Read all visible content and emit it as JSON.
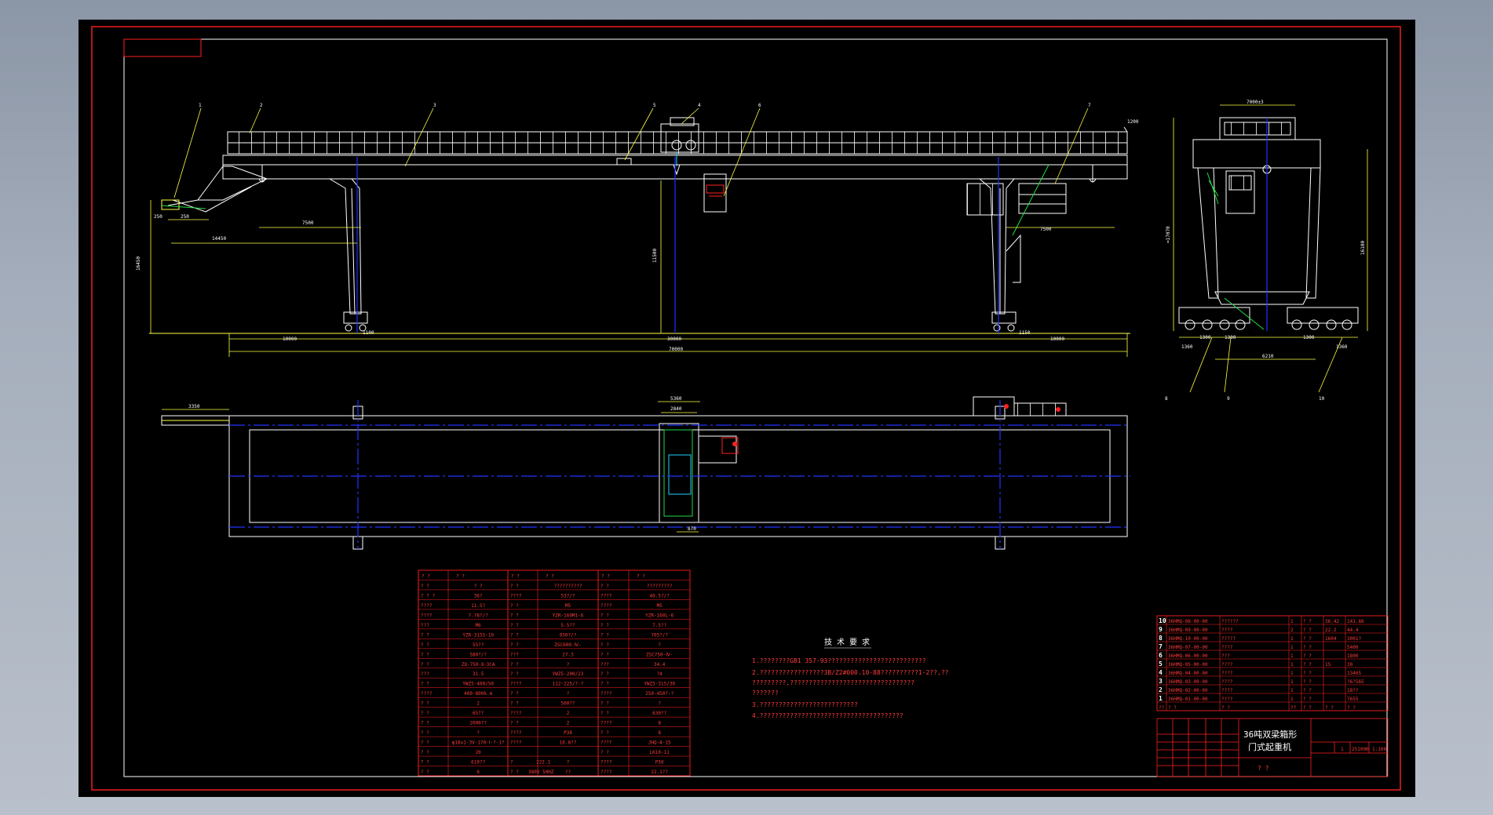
{
  "colors": {
    "paper": "#000000",
    "frame": "#ff2020",
    "line": "#ffffff",
    "dim": "#ffff33",
    "center": "#2233ff",
    "green": "#22dd44",
    "cyan": "#22d0ff"
  },
  "callouts": [
    "1",
    "2",
    "3",
    "5",
    "4",
    "6",
    "7",
    "8",
    "9",
    "10"
  ],
  "dims": {
    "elev_top": [
      "250",
      "250",
      "7500",
      "14450",
      "7500"
    ],
    "elev_v": [
      "16450",
      "11500"
    ],
    "elev_bot": [
      "10000",
      "1100",
      "30000",
      "1150",
      "10000",
      "70000"
    ],
    "plan": [
      "3350",
      "5360",
      "2840",
      "870"
    ],
    "side": [
      "7000±3",
      "≈17070",
      "16100",
      "1360",
      "1300",
      "1300",
      "1300",
      "1360",
      "6210"
    ],
    "note_1200": "1200"
  },
  "params": {
    "col_headers": [
      "? ?",
      "? ?",
      "? ?",
      "? ?",
      "? ?",
      "? ?"
    ],
    "col1": [
      [
        "? ?",
        "? ?"
      ],
      [
        "? ? ?",
        "36?"
      ],
      [
        "????",
        "11.5?"
      ],
      [
        "????",
        "7.78?/?"
      ],
      [
        "???",
        "M6"
      ],
      [
        "? ?",
        "YZR-315S-10"
      ],
      [
        "? ?",
        "55??"
      ],
      [
        "? ?",
        "580?/?"
      ],
      [
        "? ?",
        "ZQ-750-Ⅱ-3CA"
      ],
      [
        "???",
        "31.5"
      ],
      [
        "? ?",
        "YWZ5-400/50"
      ],
      [
        "????",
        "400-800k.m"
      ],
      [
        "? ?",
        "2"
      ],
      [
        "? ?",
        "65??"
      ],
      [
        "? ?",
        "2000??"
      ],
      [
        "? ?",
        "?"
      ],
      [
        "? ?",
        "φ18x1-3V-170-Ⅰ-?-1?"
      ],
      [
        "? ?",
        "20"
      ],
      [
        "? ?",
        "610??"
      ],
      [
        "? ?",
        "6"
      ]
    ],
    "col2": [
      [
        "? ?",
        "??????????"
      ],
      [
        "????",
        "53?/?"
      ],
      [
        "? ?",
        "M5"
      ],
      [
        "? ?",
        "YZR-160M1-6"
      ],
      [
        "? ?",
        "5.5??"
      ],
      [
        "? ?",
        "930?/?"
      ],
      [
        "? ?",
        "ZSC600-Ⅳ-"
      ],
      [
        "???",
        "27.3"
      ],
      [
        "? ?",
        "?"
      ],
      [
        "? ?",
        "YWZ5-200/23"
      ],
      [
        "????",
        "112-225/?-?"
      ],
      [
        "? ?",
        "?"
      ],
      [
        "? ?",
        "500??"
      ],
      [
        "????",
        "2"
      ],
      [
        "? ?",
        "2"
      ],
      [
        "????",
        "P38"
      ],
      [
        "????",
        "16.8??"
      ],
      [
        "",
        ""
      ],
      [
        "?",
        "?"
      ],
      [
        "? ?",
        "??"
      ]
    ],
    "col3": [
      [
        "? ?",
        "?????????"
      ],
      [
        "????",
        "40.5?/?"
      ],
      [
        "????",
        "M5"
      ],
      [
        "? ?",
        "YZR-160L-6"
      ],
      [
        "? ?",
        "7.5??"
      ],
      [
        "? ?",
        "705?/?"
      ],
      [
        "? ?",
        "?"
      ],
      [
        "? ?",
        "ZSC750-Ⅳ-"
      ],
      [
        "???",
        "34.4"
      ],
      [
        "? ?",
        "?4"
      ],
      [
        "? ?",
        "YWZ3-315/30"
      ],
      [
        "????",
        "250-450?-?"
      ],
      [
        "? ?",
        "?"
      ],
      [
        "? ?",
        "630??"
      ],
      [
        "????",
        "8"
      ],
      [
        "? ?",
        "8"
      ],
      [
        "????",
        "JHQ-A-15"
      ],
      [
        "? ?",
        "LK10-11"
      ],
      [
        "????",
        "P50"
      ],
      [
        "????",
        "22.1??"
      ]
    ],
    "footer": [
      "222.1",
      "380V  50HZ"
    ]
  },
  "tech": {
    "title": "技 术 要 求",
    "lines": [
      "1.????????GB1 357-93??????????????????????????",
      "2.?????????????????3B/Z2#000.10-88??????????1-2??,??",
      "  ?????????,?????????????????????????????????",
      "  ???????",
      "3.??????????????????????????",
      "4.??????????????????????????????????????"
    ]
  },
  "bom": {
    "rows": [
      [
        "10",
        "36HMQ-08-00-00",
        "??????",
        "1",
        "? ?",
        "36.42",
        "141.66"
      ],
      [
        "9",
        "36HMQ-09-00-00",
        "????",
        "2",
        "? ?",
        "22.2",
        "44.4"
      ],
      [
        "8",
        "36HMQ-10-00-00",
        "?????",
        "1",
        "? ?",
        "1604",
        "3001?"
      ],
      [
        "7",
        "36HMQ-07-00-00",
        "????",
        "1",
        "? ?",
        "",
        "5400"
      ],
      [
        "6",
        "36HMQ-06-00-00",
        "???",
        "1",
        "? ?",
        "",
        "1800"
      ],
      [
        "5",
        "36HMQ-05-00-00",
        "????",
        "1",
        "? ?",
        "15",
        "30"
      ],
      [
        "4",
        "36HMQ-04-00-00",
        "????",
        "1",
        "? ?",
        "",
        "13465"
      ],
      [
        "3",
        "36HMQ-03-00-00",
        "????",
        "1",
        "? ?",
        "",
        "?6?565"
      ],
      [
        "2",
        "36HMQ-02-00-00",
        "????",
        "1",
        "? ?",
        "",
        "18??"
      ],
      [
        "1",
        "36HMQ-01-00-00",
        "????",
        "1",
        "? ?",
        "",
        "7655"
      ]
    ],
    "header": [
      "??",
      "? ?",
      "? ?",
      "??",
      "? ?",
      "? ?",
      "? ?"
    ]
  },
  "titleblock": {
    "name1": "36吨双梁箱形",
    "name2": "门式起重机",
    "weight": "251090",
    "scale": "1:100",
    "sheet": "1",
    "sign": "? ?"
  }
}
